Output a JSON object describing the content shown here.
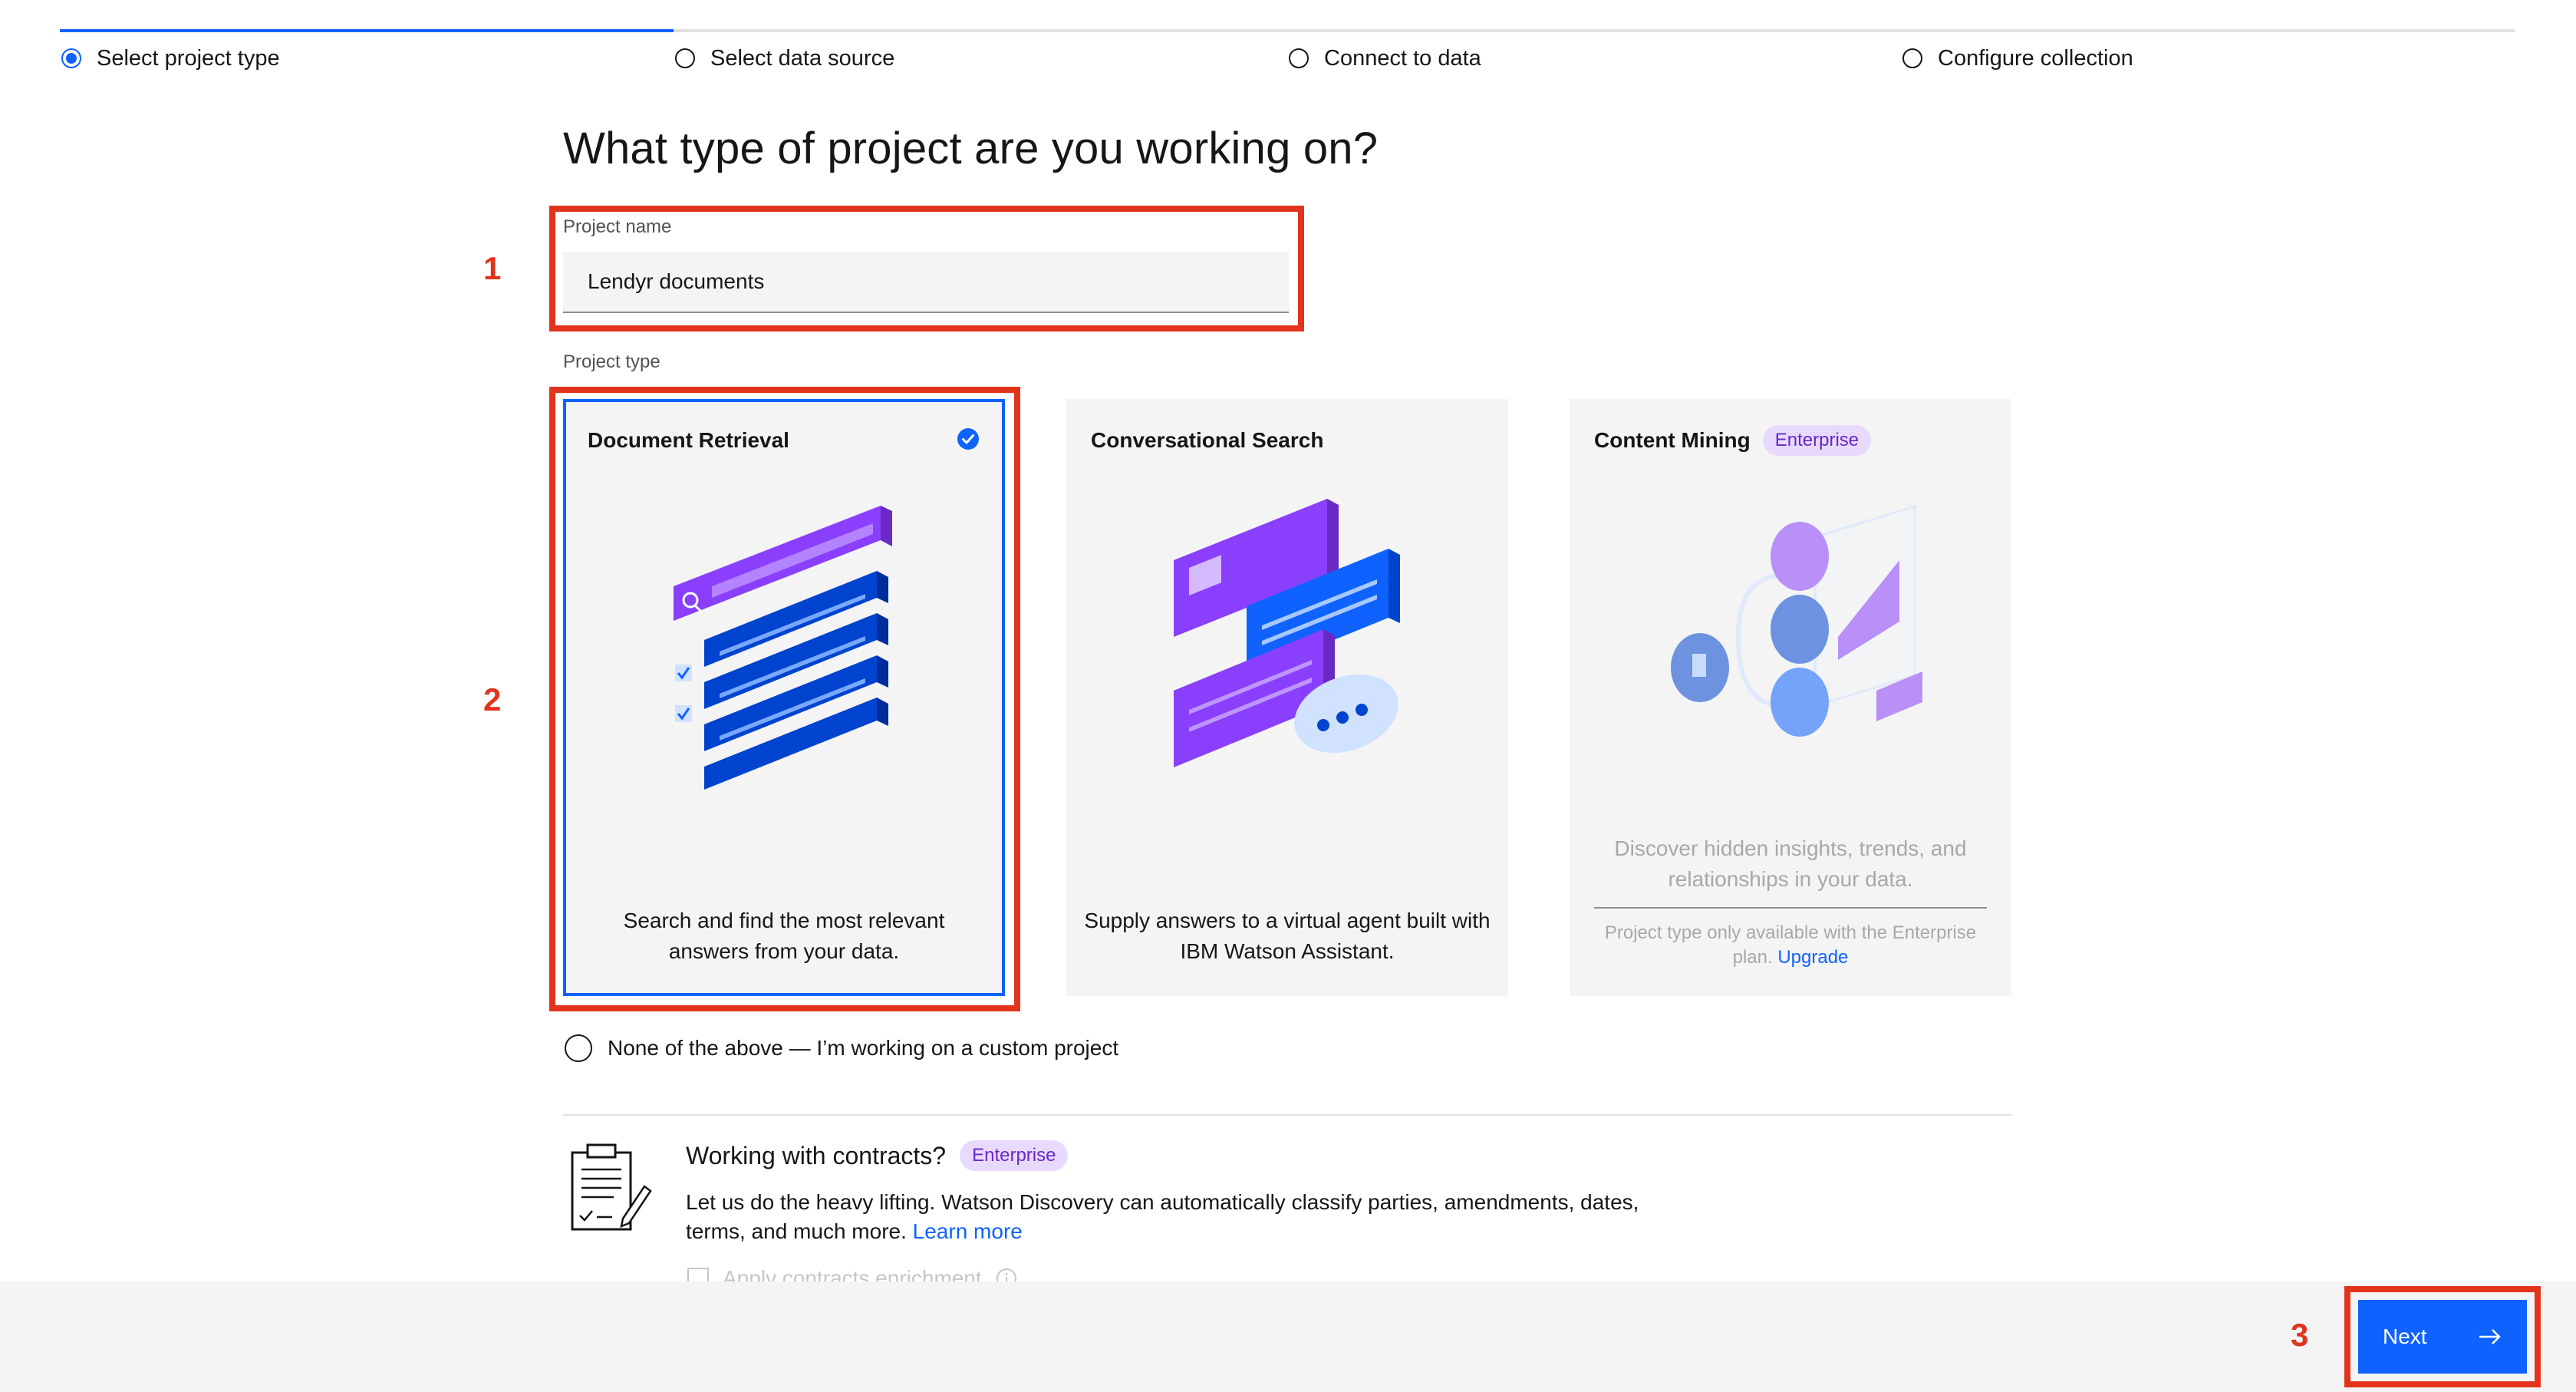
{
  "progress": {
    "steps": [
      {
        "label": "Select project type",
        "state": "current"
      },
      {
        "label": "Select data source",
        "state": "incomplete"
      },
      {
        "label": "Connect to data",
        "state": "incomplete"
      },
      {
        "label": "Configure collection",
        "state": "incomplete"
      }
    ]
  },
  "page_title": "What type of project are you working on?",
  "project_name": {
    "label": "Project name",
    "value": "Lendyr documents"
  },
  "project_type": {
    "label": "Project type",
    "tiles": [
      {
        "title": "Document Retrieval",
        "description": "Search and find the most relevant answers from your data.",
        "selected": true
      },
      {
        "title": "Conversational Search",
        "description": "Supply answers to a virtual agent built with IBM Watson Assistant.",
        "selected": false
      },
      {
        "title": "Content Mining",
        "tag": "Enterprise",
        "description": "Discover hidden insights, trends, and relationships in your data.",
        "note": "Project type only available with the Enterprise plan.",
        "note_link": "Upgrade",
        "disabled": true
      }
    ]
  },
  "custom_project": {
    "label": "None of the above — I’m working on a custom project"
  },
  "contracts": {
    "title": "Working with contracts?",
    "tag": "Enterprise",
    "description": "Let us do the heavy lifting. Watson Discovery can automatically classify parties, amendments, dates, terms, and much more.",
    "link": "Learn more",
    "checkbox_label": "Apply contracts enrichment"
  },
  "footer": {
    "next_label": "Next"
  },
  "annotations": {
    "one": "1",
    "two": "2",
    "three": "3"
  },
  "colors": {
    "primary": "#0f62fe",
    "annotation": "#e2341d",
    "tag_bg": "#e8daff",
    "tag_text": "#6929c4",
    "tile_bg": "#f4f4f4"
  }
}
